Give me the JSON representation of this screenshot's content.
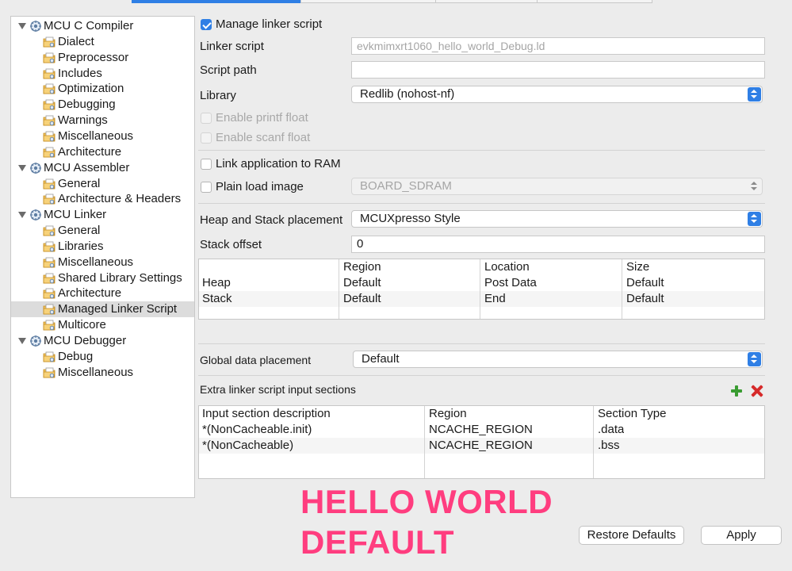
{
  "tree": {
    "groups": [
      {
        "label": "MCU C Compiler",
        "children": [
          "Dialect",
          "Preprocessor",
          "Includes",
          "Optimization",
          "Debugging",
          "Warnings",
          "Miscellaneous",
          "Architecture"
        ]
      },
      {
        "label": "MCU Assembler",
        "children": [
          "General",
          "Architecture & Headers"
        ]
      },
      {
        "label": "MCU Linker",
        "children": [
          "General",
          "Libraries",
          "Miscellaneous",
          "Shared Library Settings",
          "Architecture",
          "Managed Linker Script",
          "Multicore"
        ]
      },
      {
        "label": "MCU Debugger",
        "children": [
          "Debug",
          "Miscellaneous"
        ]
      }
    ],
    "selected": "Managed Linker Script"
  },
  "form": {
    "manage_linker_script": {
      "label": "Manage linker script",
      "checked": true
    },
    "linker_script": {
      "label": "Linker script",
      "value": "evkmimxrt1060_hello_world_Debug.ld"
    },
    "script_path": {
      "label": "Script path",
      "value": ""
    },
    "library": {
      "label": "Library",
      "value": "Redlib (nohost-nf)"
    },
    "enable_printf_float": {
      "label": "Enable printf float",
      "checked": false
    },
    "enable_scanf_float": {
      "label": "Enable scanf float",
      "checked": false
    },
    "link_to_ram": {
      "label": "Link application to RAM",
      "checked": false
    },
    "plain_load_image": {
      "label": "Plain load image",
      "checked": false,
      "value": "BOARD_SDRAM"
    },
    "heap_stack_placement": {
      "label": "Heap and Stack placement",
      "value": "MCUXpresso Style"
    },
    "stack_offset": {
      "label": "Stack offset",
      "value": "0"
    },
    "global_data_placement": {
      "label": "Global data placement",
      "value": "Default"
    },
    "extra_sections_label": "Extra linker script input sections"
  },
  "heap_stack_table": {
    "columns": [
      "",
      "Region",
      "Location",
      "Size"
    ],
    "rows": [
      [
        "Heap",
        "Default",
        "Post Data",
        "Default"
      ],
      [
        "Stack",
        "Default",
        "End",
        "Default"
      ]
    ]
  },
  "sections_table": {
    "columns": [
      "Input section description",
      "Region",
      "Section Type"
    ],
    "rows": [
      [
        "*(NonCacheable.init)",
        "NCACHE_REGION",
        ".data"
      ],
      [
        "*(NonCacheable)",
        "NCACHE_REGION",
        ".bss"
      ]
    ]
  },
  "buttons": {
    "restore_defaults": "Restore Defaults",
    "apply": "Apply"
  },
  "overlay": {
    "line1": "HELLO WORLD",
    "line2": "DEFAULT",
    "color": "#ff3d7f"
  },
  "colors": {
    "accent": "#2f7fe5"
  }
}
